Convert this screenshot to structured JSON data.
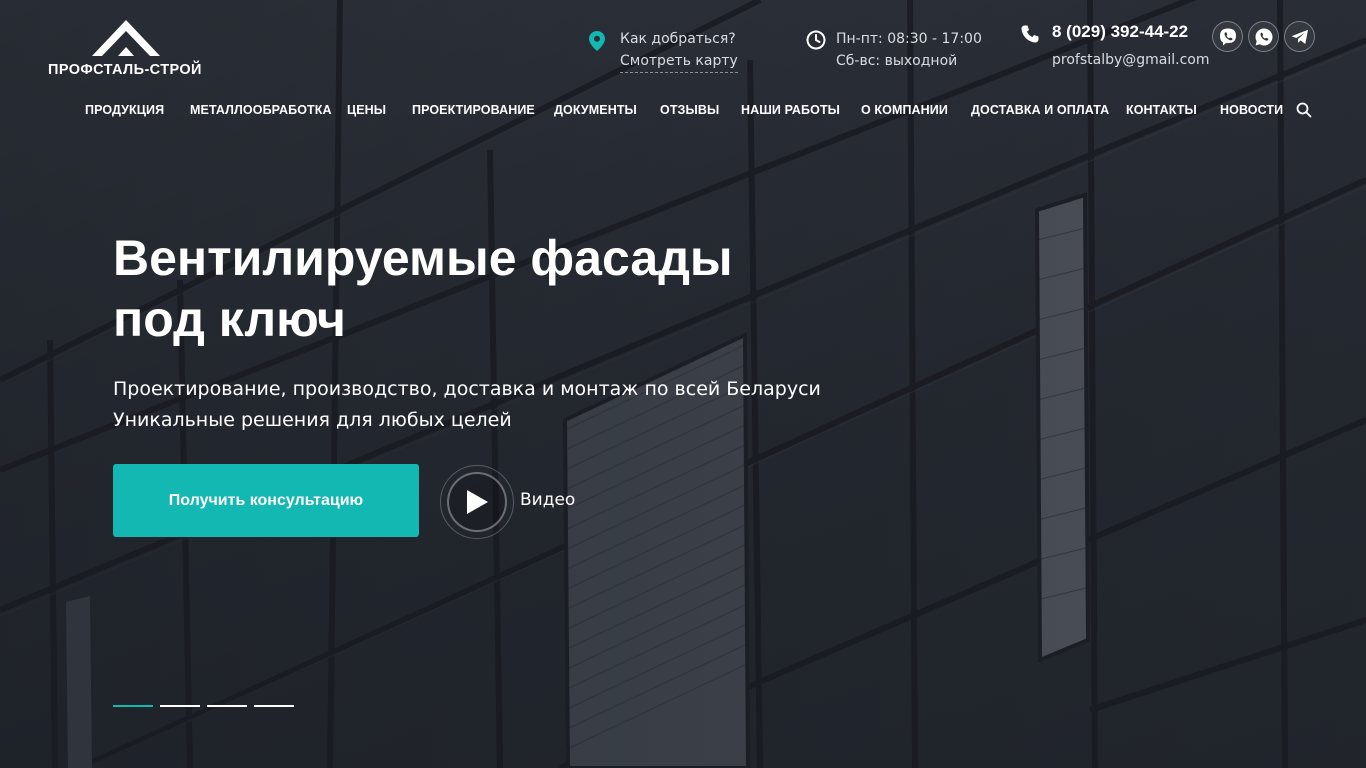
{
  "brand": {
    "logo_text": "ПРОФСТАЛЬ-СТРОЙ",
    "accent_color": "#12b8b1",
    "logo_icon": "roof-house-icon"
  },
  "header": {
    "address": {
      "icon": "map-pin-icon",
      "question": "Как добраться?",
      "map_link": "Смотреть карту"
    },
    "hours": {
      "icon": "clock-icon",
      "weekdays": "Пн-пт: 08:30 - 17:00",
      "weekend": "Сб-вс: выходной"
    },
    "contacts": {
      "icon": "phone-icon",
      "phone": "8 (029) 392-44-22",
      "email": "profstalby@gmail.com"
    },
    "social": [
      {
        "name": "viber",
        "icon": "viber-icon"
      },
      {
        "name": "whatsapp",
        "icon": "whatsapp-icon"
      },
      {
        "name": "telegram",
        "icon": "telegram-icon"
      }
    ]
  },
  "nav": {
    "items": [
      "ПРОДУКЦИЯ",
      "МЕТАЛЛООБРАБОТКА",
      "ЦЕНЫ",
      "ПРОЕКТИРОВАНИЕ",
      "ДОКУМЕНТЫ",
      "ОТЗЫВЫ",
      "НАШИ РАБОТЫ",
      "О КОМПАНИИ",
      "ДОСТАВКА И ОПЛАТА",
      "КОНТАКТЫ",
      "НОВОСТИ"
    ],
    "search_icon": "search-icon"
  },
  "hero": {
    "title": "Вентилируемые фасады под ключ",
    "subtitle_line1": "Проектирование, производство, доставка и монтаж по всей Беларуси",
    "subtitle_line2": "Уникальные решения для любых целей",
    "cta_label": "Получить консультацию",
    "video_label": "Видео",
    "video_icon": "play-icon"
  },
  "slider": {
    "slide_count": 4,
    "active_index": 0
  }
}
